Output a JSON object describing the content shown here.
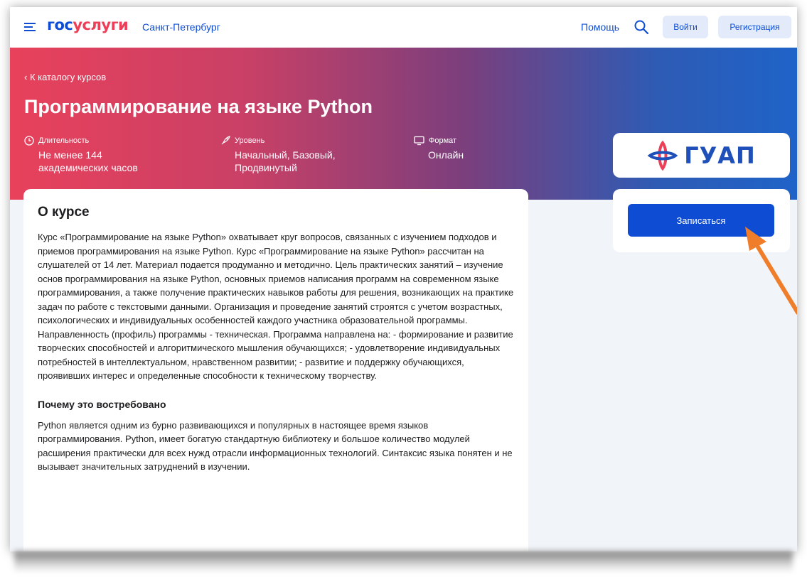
{
  "header": {
    "logo_part1": "гос",
    "logo_part2": "услуги",
    "city": "Санкт-Петербург",
    "help": "Помощь",
    "login": "Войти",
    "register": "Регистрация"
  },
  "hero": {
    "back_link": "‹ К каталогу курсов",
    "title": "Программирование на языке Python",
    "meta": [
      {
        "label": "Длительность",
        "value": "Не менее 144 академических часов",
        "icon": "clock-icon"
      },
      {
        "label": "Уровень",
        "value": "Начальный, Базовый, Продвинутый",
        "icon": "rocket-icon"
      },
      {
        "label": "Формат",
        "value": "Онлайн",
        "icon": "monitor-icon"
      }
    ]
  },
  "org": {
    "name": "ГУАП"
  },
  "enroll": {
    "label": "Записаться"
  },
  "about": {
    "heading": "О курсе",
    "text": "Курс «Программирование на языке Python» охватывает круг вопросов, связанных с изучением подходов и приемов программирования на языке Python. Курс «Программирование на языке Python» рассчитан на слушателей от 14 лет. Материал подается продуманно и методично. Цель практических занятий – изучение основ программирования на языке Python, основных приемов написания программ на современном языке программирования, а также получение практических навыков работы для решения, возникающих на практике задач по работе с текстовыми данными. Организация и проведение занятий строятся с учетом возрастных, психологических и индивидуальных особенностей каждого участника образовательной программы. Направленность (профиль) программы - техническая. Программа направлена на: - формирование и развитие творческих способностей и алгоритмического мышления обучающихся; - удовлетворение индивидуальных потребностей в интеллектуальном, нравственном развитии; - развитие и поддержку обучающихся, проявивших интерес и определенные способности к техническому творчеству.",
    "why_heading": "Почему это востребовано",
    "why_text": "Python является одним из бурно развивающихся и популярных в настоящее время языков программирования. Python, имеет богатую стандартную библиотеку и большое количество модулей расширения практически для всех нужд отрасли информационных технологий. Синтаксис языка понятен и не вызывает значительных затруднений в изучении."
  },
  "colors": {
    "brand_blue": "#0d4cd3",
    "brand_red": "#ee3f58",
    "annotation_arrow": "#f07d2a"
  }
}
